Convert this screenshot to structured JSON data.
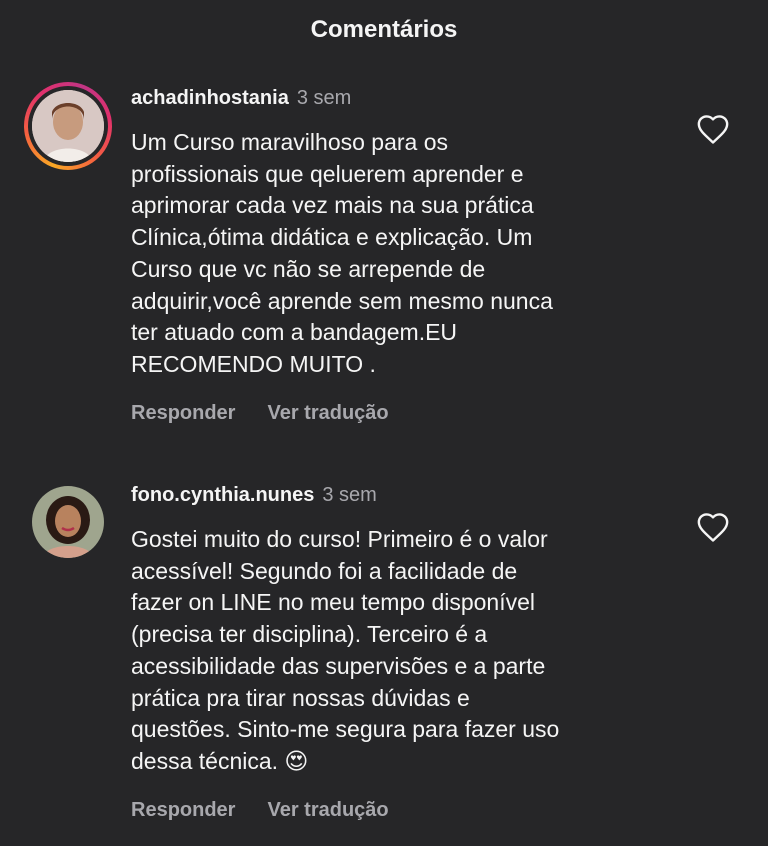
{
  "header": {
    "title": "Comentários"
  },
  "comments": [
    {
      "username": "achadinhostania",
      "time": "3 sem",
      "text": "Um Curso maravilhoso para os\nprofissionais que qeluerem aprender e\naprimorar cada vez mais na sua prática\nClínica,ótima didática e explicação. Um\nCurso que vc não se arrepende de\nadquirir,você aprende sem mesmo nunca\nter atuado com a bandagem.EU\nRECOMENDO MUITO .",
      "reply_label": "Responder",
      "translate_label": "Ver tradução",
      "has_story_ring": true,
      "like_icon": "heart-outline-icon"
    },
    {
      "username": "fono.cynthia.nunes",
      "time": "3 sem",
      "text": "Gostei muito do curso! Primeiro é o valor\nacessível! Segundo foi a facilidade de\nfazer on LINE no meu tempo disponível\n(precisa ter disciplina). Terceiro é a\nacessibilidade das supervisões e a parte\nprática pra tirar nossas dúvidas e\nquestões. Sinto-me segura para fazer uso\ndessa técnica. 😍",
      "reply_label": "Responder",
      "translate_label": "Ver tradução",
      "has_story_ring": false,
      "like_icon": "heart-outline-icon"
    }
  ],
  "colors": {
    "background": "#262628",
    "text": "#f5f5f5",
    "secondary_text": "#a8a8ad"
  }
}
